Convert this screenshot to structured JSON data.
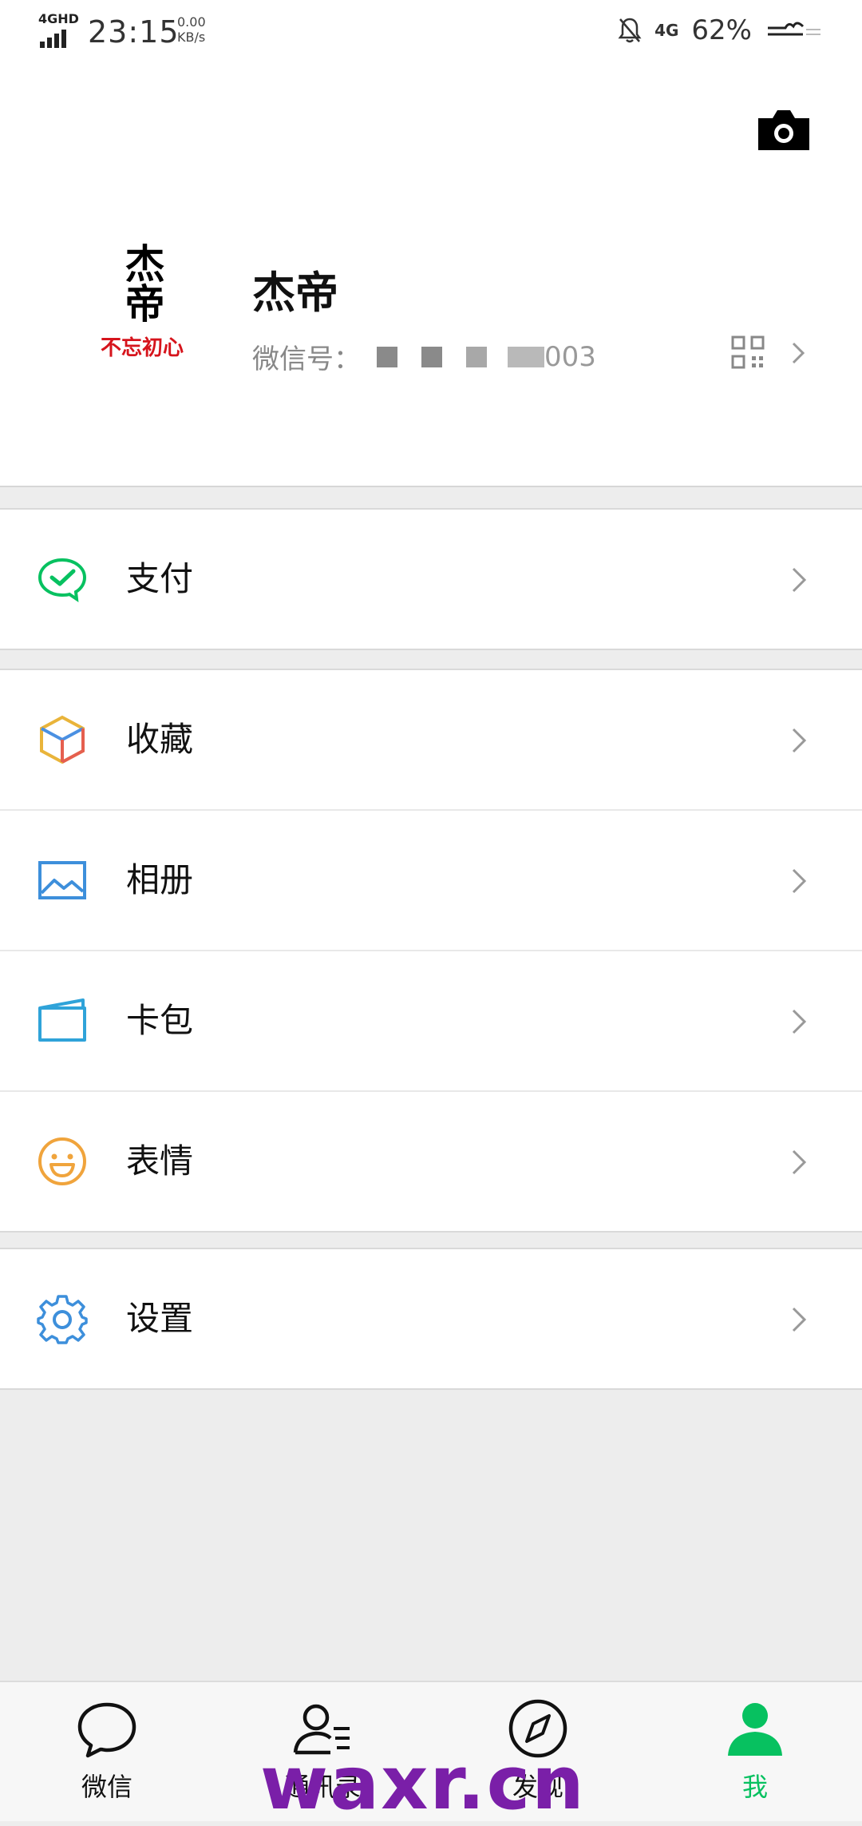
{
  "status_bar": {
    "network": "4GHD",
    "time": "23:15",
    "speed_value": "0.00",
    "speed_unit": "KB/s",
    "mobile_data": "4G",
    "battery": "62%"
  },
  "profile": {
    "avatar_text": "杰帝",
    "avatar_subtext": "不忘初心",
    "name": "杰帝",
    "wechat_id_label": "微信号：",
    "wechat_id_suffix": "003"
  },
  "menu": {
    "pay": "支付",
    "favorites": "收藏",
    "album": "相册",
    "cards": "卡包",
    "stickers": "表情",
    "settings": "设置"
  },
  "tabs": {
    "chats": "微信",
    "contacts": "通讯录",
    "discover": "发现",
    "me": "我"
  },
  "watermark": "waxr.cn",
  "colors": {
    "accent_green": "#07c160",
    "background": "#ededed",
    "watermark": "#7a1fa8"
  }
}
